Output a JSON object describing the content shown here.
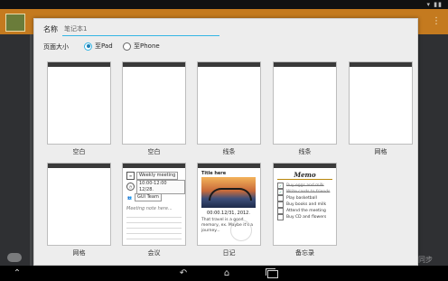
{
  "background": {
    "right_label": "同步"
  },
  "dialog": {
    "name_label": "名称",
    "name_value": "笔记本1",
    "page_size_label": "页面大小",
    "size_options": [
      "至Pad",
      "至Phone"
    ],
    "selected_size": "至Pad"
  },
  "templates": [
    {
      "label": "空白"
    },
    {
      "label": "空白"
    },
    {
      "label": "线条"
    },
    {
      "label": "线条"
    },
    {
      "label": "网格"
    },
    {
      "label": "网格"
    },
    {
      "label": "会议",
      "content": {
        "meeting_title": "Weekly meeting",
        "time": "10:00-12:00 12/28.",
        "team": "GUI Team",
        "note_placeholder": "Meeting note here..."
      }
    },
    {
      "label": "日记",
      "content": {
        "title": "Title here",
        "date": "00:00.12/31, 2012.",
        "body": "That travel is a good memory, ex. Maybe it's a journey..."
      }
    },
    {
      "label": "备忘录",
      "content": {
        "title": "Memo",
        "items": [
          {
            "text": "Buy eggs and milk",
            "done": true
          },
          {
            "text": "Write cards to friends",
            "done": true
          },
          {
            "text": "Play basketball",
            "done": false
          },
          {
            "text": "Buy books and milk",
            "done": false
          },
          {
            "text": "Attend the meeting",
            "done": false
          },
          {
            "text": "Buy CD and flowers",
            "done": false
          }
        ]
      }
    }
  ],
  "colors": {
    "accent": "#33b5e5",
    "appbar": "#c47a1f",
    "paper_cream": "#f6f2c9"
  },
  "navbar": {
    "icons": [
      "keyboard-hide-icon",
      "back-icon",
      "home-icon",
      "recent-apps-icon"
    ]
  }
}
